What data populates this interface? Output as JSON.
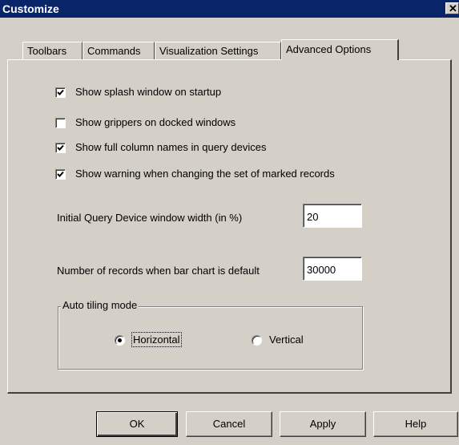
{
  "window": {
    "title": "Customize",
    "close_glyph": "✕"
  },
  "tabs": [
    {
      "label": "Toolbars",
      "active": false
    },
    {
      "label": "Commands",
      "active": false
    },
    {
      "label": "Visualization Settings",
      "active": false
    },
    {
      "label": "Advanced Options",
      "active": true
    }
  ],
  "options": [
    {
      "label": "Show splash window on startup",
      "checked": true
    },
    {
      "label": "Show grippers on docked windows",
      "checked": false
    },
    {
      "label": "Show full column names in query devices",
      "checked": true
    },
    {
      "label": "Show warning when changing the set of marked records",
      "checked": true
    }
  ],
  "fields": {
    "qd_width": {
      "label": "Initial Query Device window width (in %)",
      "value": "20"
    },
    "bar_records": {
      "label": "Number of records when bar chart is default",
      "value": "30000"
    }
  },
  "tiling": {
    "legend": "Auto tiling mode",
    "options": [
      {
        "label": "Horizontal",
        "selected": true
      },
      {
        "label": "Vertical",
        "selected": false
      }
    ]
  },
  "buttons": {
    "ok": "OK",
    "cancel": "Cancel",
    "apply": "Apply",
    "help": "Help"
  },
  "icons": {
    "close": "close-icon",
    "check": "checkmark-icon"
  }
}
